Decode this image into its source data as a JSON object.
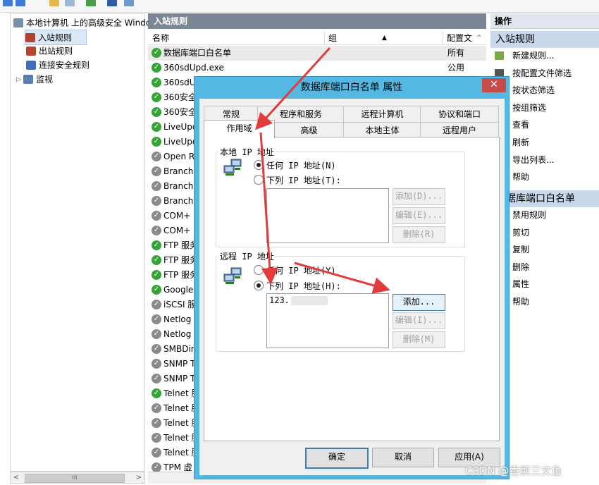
{
  "tree": {
    "root": "本地计算机 上的高级安全 Windows",
    "items": [
      "入站规则",
      "出站规则",
      "连接安全规则",
      "监视"
    ]
  },
  "middle": {
    "title": "入站规则",
    "columns": [
      "名称",
      "组",
      "配置文"
    ],
    "rules": [
      {
        "name": "数据库端口白名单",
        "profile": "所有",
        "enabled": true
      },
      {
        "name": "360sdUpd.exe",
        "profile": "公用",
        "enabled": true
      },
      {
        "name": "360sdU",
        "profile": "",
        "enabled": true
      },
      {
        "name": "360安全",
        "profile": "",
        "enabled": true
      },
      {
        "name": "360安全",
        "profile": "",
        "enabled": true
      },
      {
        "name": "LiveUpd",
        "profile": "",
        "enabled": true
      },
      {
        "name": "LiveUpd",
        "profile": "",
        "enabled": true
      },
      {
        "name": "Open R",
        "profile": "",
        "enabled": false
      },
      {
        "name": "BranchC",
        "profile": "",
        "enabled": false
      },
      {
        "name": "BranchC",
        "profile": "",
        "enabled": false
      },
      {
        "name": "BranchC",
        "profile": "",
        "enabled": false
      },
      {
        "name": "COM+",
        "profile": "",
        "enabled": false
      },
      {
        "name": "COM+",
        "profile": "",
        "enabled": false
      },
      {
        "name": "FTP 服务",
        "profile": "",
        "enabled": true
      },
      {
        "name": "FTP 服务",
        "profile": "",
        "enabled": true
      },
      {
        "name": "FTP 服务",
        "profile": "",
        "enabled": true
      },
      {
        "name": "Google",
        "profile": "",
        "enabled": true
      },
      {
        "name": "iSCSI 服",
        "profile": "",
        "enabled": false
      },
      {
        "name": "Netlog",
        "profile": "",
        "enabled": false
      },
      {
        "name": "Netlog",
        "profile": "",
        "enabled": false
      },
      {
        "name": "SMBDir",
        "profile": "",
        "enabled": false
      },
      {
        "name": "SNMP T",
        "profile": "",
        "enabled": false
      },
      {
        "name": "SNMP T",
        "profile": "",
        "enabled": false
      },
      {
        "name": "Telnet 服",
        "profile": "",
        "enabled": true
      },
      {
        "name": "Telnet 服",
        "profile": "",
        "enabled": false
      },
      {
        "name": "Telnet 服",
        "profile": "",
        "enabled": false
      },
      {
        "name": "Telnet 服",
        "profile": "",
        "enabled": false
      },
      {
        "name": "Telnet 服",
        "profile": "",
        "enabled": false
      },
      {
        "name": "TPM 虚",
        "profile": "",
        "enabled": false
      }
    ]
  },
  "actions": {
    "title": "操作",
    "section1": "入站规则",
    "items1": [
      "新建规则...",
      "按配置文件筛选",
      "按状态筛选",
      "按组筛选",
      "查看",
      "刷新",
      "导出列表...",
      "帮助"
    ],
    "section2": "据库端口白名单",
    "items2": [
      "禁用规则",
      "剪切",
      "复制",
      "删除",
      "属性",
      "帮助"
    ]
  },
  "dialog": {
    "title": "数据库端口白名单 属性",
    "close": "✕",
    "tabs_row1": [
      "常规",
      "程序和服务",
      "远程计算机",
      "协议和端口"
    ],
    "tabs_row2": [
      "作用域",
      "高级",
      "本地主体",
      "远程用户"
    ],
    "local": {
      "legend": "本地 IP 地址",
      "any": "任何 IP 地址(N)",
      "these": "下列 IP 地址(T):",
      "add": "添加(D)...",
      "edit": "编辑(E)...",
      "remove": "删除(R)"
    },
    "remote": {
      "legend": "远程 IP 地址",
      "any": "任何 IP 地址(Y)",
      "these": "下列 IP 地址(H):",
      "entry": "123.",
      "add": "添加...",
      "edit": "编辑(I)...",
      "remove": "删除(M)"
    },
    "ok": "确定",
    "cancel": "取消",
    "apply": "应用(A)"
  },
  "scrollbar": {
    "thumb_label": "III"
  },
  "watermark": "CSDN @香煎三文鱼"
}
